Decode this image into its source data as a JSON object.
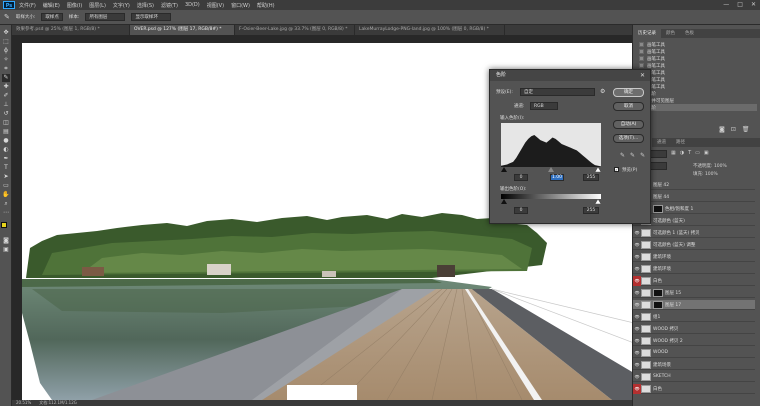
{
  "menu": [
    "文件(F)",
    "编辑(E)",
    "图像(I)",
    "图层(L)",
    "文字(Y)",
    "选择(S)",
    "滤镜(T)",
    "3D(D)",
    "视图(V)",
    "窗口(W)",
    "帮助(H)"
  ],
  "app_logo": "Ps",
  "window_controls": [
    "—",
    "□",
    "✕"
  ],
  "options_bar": {
    "sample_size_label": "取样大小:",
    "sample_size": "取样点",
    "sample_label": "样本:",
    "sample": "所有图层",
    "show_ring": "显示取样环"
  },
  "tabs": [
    {
      "label": "效果参考.psd @ 25% (图层 1, RGB/8) *",
      "active": false
    },
    {
      "label": "OVER.psd @ 127% (图层 17, RGB/8#) *",
      "active": true
    },
    {
      "label": "F-Osier-Beer-Lake.jpg @ 33.7% (图层 0, RGB/8) *",
      "active": false
    },
    {
      "label": "LakeMurrayLodge-PNG-land.jpg @ 100% (图层 0, RGB/8) *",
      "active": false
    }
  ],
  "status_bar": {
    "zoom": "20.51%",
    "doc": "文档:112.1M/1.12G"
  },
  "panels": {
    "history_tabs": [
      "历史记录",
      "颜色",
      "色板"
    ],
    "history_items": [
      "画笔工具",
      "画笔工具",
      "画笔工具",
      "画笔工具",
      "画笔工具",
      "画笔工具",
      "画笔工具",
      "色阶",
      "合并可见图层",
      "色阶"
    ],
    "layers_tabs": [
      "图层",
      "通道",
      "路径"
    ],
    "layer_search_placeholder": "类型",
    "blend_mode": "正常",
    "opacity_label": "不透明度: 100%",
    "fill_label": "填充: 100%",
    "layers": [
      {
        "name": "图层 42",
        "eye_red": false
      },
      {
        "name": "图层 44",
        "eye_red": false
      },
      {
        "name": "色相/饱和度 1",
        "eye_red": false
      },
      {
        "name": "可选颜色 (蓝天)",
        "eye_red": false
      },
      {
        "name": "可选颜色 1 (蓝天) 拷贝",
        "eye_red": false
      },
      {
        "name": "可选颜色 (蓝天) 调整",
        "eye_red": false
      },
      {
        "name": "建筑环境",
        "eye_red": false
      },
      {
        "name": "建筑环境",
        "eye_red": false
      },
      {
        "name": "白色",
        "eye_red": true
      },
      {
        "name": "图层 15",
        "eye_red": false
      },
      {
        "name": "图层 17",
        "eye_red": false
      },
      {
        "name": "组1",
        "eye_red": false
      },
      {
        "name": "WOOD 拷贝",
        "eye_red": false
      },
      {
        "name": "WOOD 拷贝 2",
        "eye_red": false
      },
      {
        "name": "WOOD",
        "eye_red": false
      },
      {
        "name": "建筑场景",
        "eye_red": false
      },
      {
        "name": "SKETCH",
        "eye_red": false
      },
      {
        "name": "白色",
        "eye_red": true
      }
    ]
  },
  "levels_dialog": {
    "title": "色阶",
    "preset_label": "预设(E):",
    "preset_value": "自定",
    "channel_label": "通道:",
    "channel_value": "RGB",
    "input_label": "输入色阶(I):",
    "output_label": "输出色阶(O):",
    "input_values": [
      "0",
      "1.00",
      "255"
    ],
    "output_values": [
      "0",
      "255"
    ],
    "buttons": {
      "ok": "确定",
      "cancel": "取消",
      "auto": "自动(A)",
      "options": "选项(T)..."
    },
    "preview_label": "预览(P)",
    "histogram": [
      2,
      3,
      4,
      6,
      8,
      14,
      22,
      30,
      38,
      44,
      48,
      50,
      46,
      42,
      40,
      38,
      42,
      46,
      44,
      40,
      36,
      34,
      32,
      30,
      28,
      26,
      22,
      18,
      14,
      10,
      6,
      3,
      2,
      1
    ]
  },
  "colors": {
    "foreground": "#e8d41c",
    "background": "#c8c8c8",
    "accent_red": "#b33030",
    "highlight_blue": "#2f6fbf"
  }
}
